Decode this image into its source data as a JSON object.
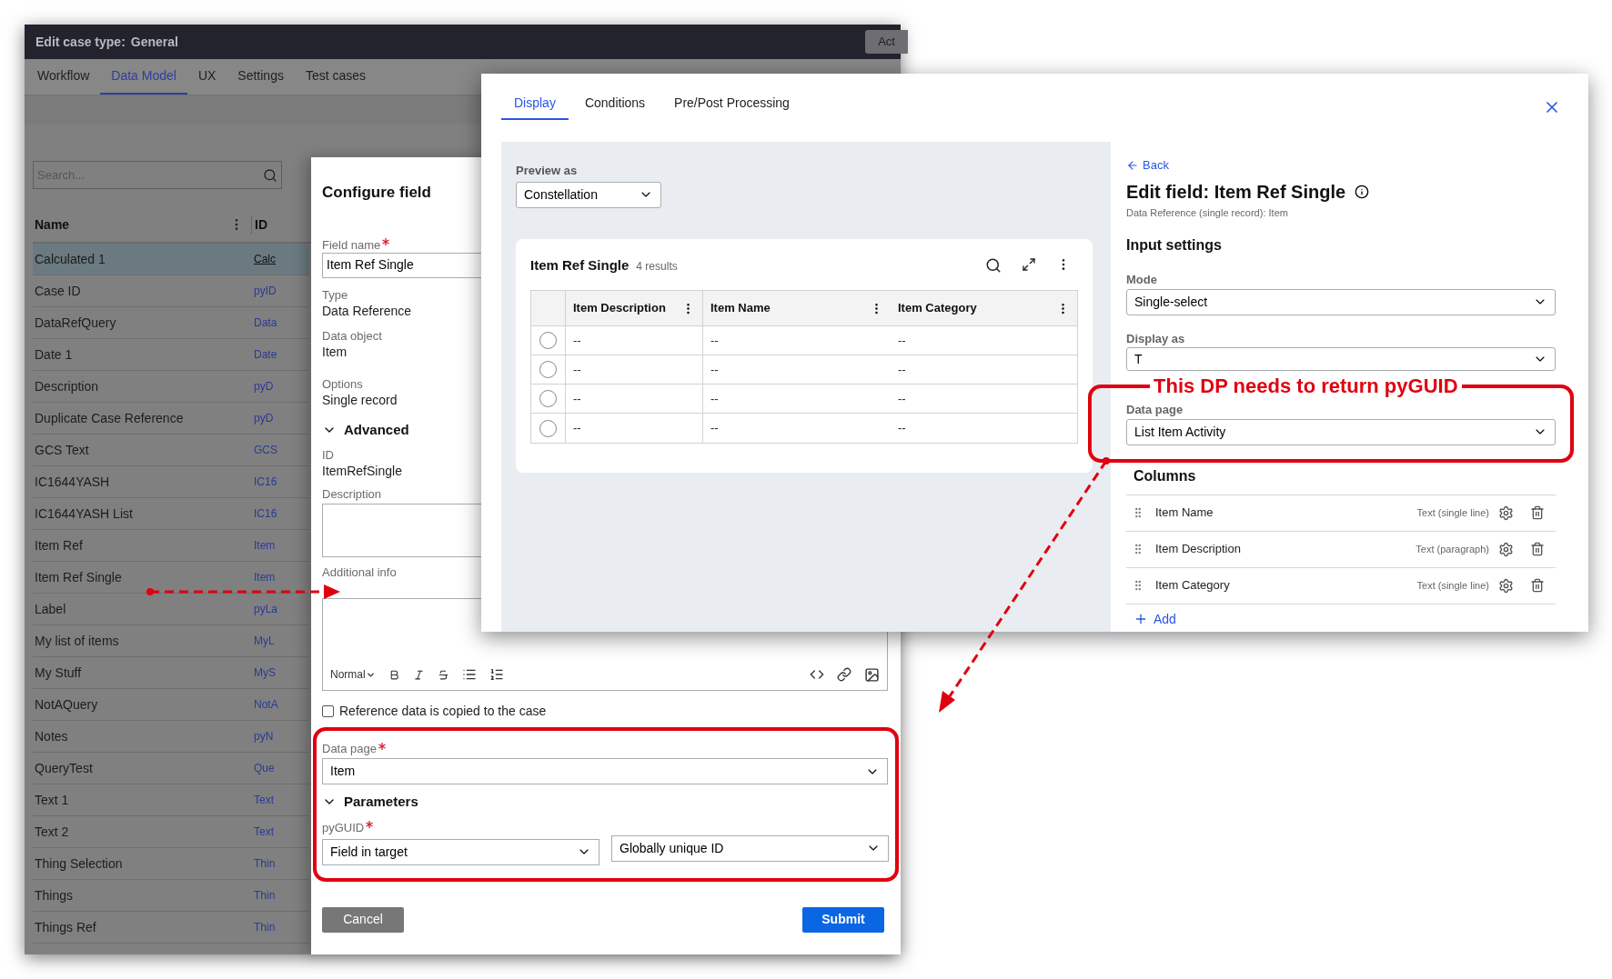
{
  "background_window": {
    "title_label": "Edit case type:",
    "title_value": "General",
    "action_button": "Act",
    "tabs": [
      {
        "label": "Workflow",
        "selected": false
      },
      {
        "label": "Data Model",
        "selected": true
      },
      {
        "label": "UX",
        "selected": false
      },
      {
        "label": "Settings",
        "selected": false
      },
      {
        "label": "Test cases",
        "selected": false
      }
    ],
    "search": {
      "placeholder": "Search..."
    },
    "table": {
      "columns": [
        "Name",
        "ID"
      ],
      "rows": [
        {
          "name": "Calculated 1",
          "id": "Calc",
          "selected": true
        },
        {
          "name": "Case ID",
          "id": "pyID",
          "selected": false
        },
        {
          "name": "DataRefQuery",
          "id": "Data",
          "selected": false
        },
        {
          "name": "Date 1",
          "id": "Date",
          "selected": false
        },
        {
          "name": "Description",
          "id": "pyD",
          "selected": false
        },
        {
          "name": "Duplicate Case Reference",
          "id": "pyD",
          "selected": false
        },
        {
          "name": "GCS Text",
          "id": "GCS",
          "selected": false
        },
        {
          "name": "IC1644YASH",
          "id": "IC16",
          "selected": false
        },
        {
          "name": "IC1644YASH List",
          "id": "IC16",
          "selected": false
        },
        {
          "name": "Item Ref",
          "id": "Item",
          "selected": false
        },
        {
          "name": "Item Ref Single",
          "id": "Item",
          "selected": false
        },
        {
          "name": "Label",
          "id": "pyLa",
          "selected": false
        },
        {
          "name": "My list of items",
          "id": "MyL",
          "selected": false
        },
        {
          "name": "My Stuff",
          "id": "MyS",
          "selected": false
        },
        {
          "name": "NotAQuery",
          "id": "NotA",
          "selected": false
        },
        {
          "name": "Notes",
          "id": "pyN",
          "selected": false
        },
        {
          "name": "QueryTest",
          "id": "Que",
          "selected": false
        },
        {
          "name": "Text 1",
          "id": "Text",
          "selected": false
        },
        {
          "name": "Text 2",
          "id": "Text",
          "selected": false
        },
        {
          "name": "Thing Selection",
          "id": "Thin",
          "selected": false
        },
        {
          "name": "Things",
          "id": "Thin",
          "selected": false
        },
        {
          "name": "Things Ref",
          "id": "Thin",
          "selected": false
        }
      ]
    }
  },
  "configure_field": {
    "title": "Configure field",
    "field_name": {
      "label": "Field name",
      "required": true,
      "value": "Item Ref Single"
    },
    "type": {
      "label": "Type",
      "value": "Data Reference"
    },
    "data_object": {
      "label": "Data object",
      "value": "Item"
    },
    "options": {
      "label": "Options",
      "value": "Single record"
    },
    "advanced": {
      "label": "Advanced",
      "expanded": true
    },
    "id": {
      "label": "ID",
      "value": "ItemRefSingle"
    },
    "description": {
      "label": "Description"
    },
    "additional_info": {
      "label": "Additional info",
      "format": "Normal"
    },
    "copy_checkbox": {
      "label": "Reference data is copied to the case",
      "checked": false
    },
    "data_page": {
      "label": "Data page",
      "required": true,
      "value": "Item"
    },
    "parameters": {
      "label": "Parameters",
      "expanded": true
    },
    "pyguid": {
      "label": "pyGUID",
      "required": true,
      "source": "Field in target",
      "value": "Globally unique ID"
    },
    "buttons": {
      "cancel": "Cancel",
      "submit": "Submit"
    }
  },
  "edit_dialog": {
    "tabs": [
      {
        "label": "Display",
        "selected": true
      },
      {
        "label": "Conditions",
        "selected": false
      },
      {
        "label": "Pre/Post Processing",
        "selected": false
      }
    ],
    "preview": {
      "label": "Preview as",
      "value": "Constellation",
      "card": {
        "title": "Item Ref Single",
        "count": "4 results",
        "columns": [
          "Item Description",
          "Item Name",
          "Item Category"
        ],
        "rows": [
          {
            "selected": false,
            "cells": [
              "--",
              "--",
              "--"
            ]
          },
          {
            "selected": false,
            "cells": [
              "--",
              "--",
              "--"
            ]
          },
          {
            "selected": false,
            "cells": [
              "--",
              "--",
              "--"
            ]
          },
          {
            "selected": false,
            "cells": [
              "--",
              "--",
              "--"
            ]
          }
        ]
      }
    },
    "panel": {
      "back": "Back",
      "title": "Edit field: Item Ref Single",
      "subtitle": "Data Reference (single record): Item",
      "section": "Input settings",
      "mode": {
        "label": "Mode",
        "value": "Single-select"
      },
      "display_as": {
        "label": "Display as",
        "value": "T"
      },
      "data_page": {
        "label": "Data page",
        "value": "List Item Activity"
      },
      "columns_heading": "Columns",
      "columns": [
        {
          "name": "Item Name",
          "type": "Text (single line)"
        },
        {
          "name": "Item Description",
          "type": "Text (paragraph)"
        },
        {
          "name": "Item Category",
          "type": "Text (single line)"
        }
      ],
      "add": "Add"
    }
  },
  "annotations": {
    "callout": "This DP needs to return pyGUID"
  }
}
